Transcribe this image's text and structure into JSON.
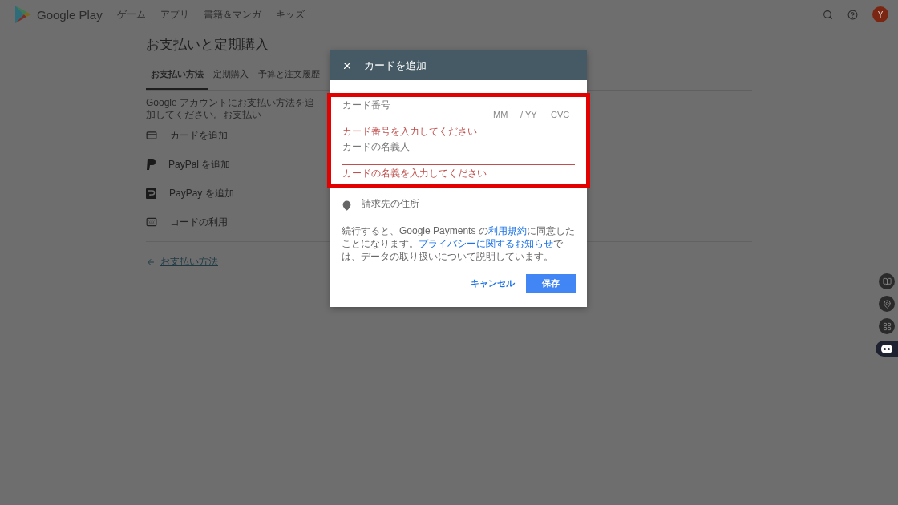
{
  "header": {
    "brand": "Google Play",
    "nav": [
      {
        "label": "ゲーム",
        "selected": false
      },
      {
        "label": "アプリ",
        "selected": false
      },
      {
        "label": "書籍＆マンガ",
        "selected": false
      },
      {
        "label": "キッズ",
        "selected": false
      }
    ],
    "avatar": "Y"
  },
  "page": {
    "title": "お支払いと定期購入",
    "tabs": [
      {
        "label": "お支払い方法",
        "selected": true
      },
      {
        "label": "定期購入",
        "selected": false
      },
      {
        "label": "予算と注文履歴",
        "selected": false
      }
    ],
    "description": "Google アカウントにお支払い方法を追加してください。お支払い",
    "methods": [
      {
        "kind": "card",
        "label": "カードを追加"
      },
      {
        "kind": "paypal",
        "label": "PayPal を追加"
      },
      {
        "kind": "paypay",
        "label": "PayPay を追加"
      },
      {
        "kind": "code",
        "label": "コードの利用"
      }
    ],
    "back_link": "お支払い方法"
  },
  "dialog": {
    "title": "カードを追加",
    "highlighted": true,
    "card_number": {
      "label": "カード番号",
      "error": "カード番号を入力してください"
    },
    "expiry_month": {
      "placeholder": "MM"
    },
    "expiry_year": {
      "placeholder": "/ YY"
    },
    "cvc": {
      "placeholder": "CVC"
    },
    "cardholder": {
      "label": "カードの名義人",
      "error": "カードの名義を入力してください"
    },
    "address": {
      "placeholder": "請求先の住所"
    },
    "terms": [
      {
        "text": "続行すると、Google Payments の",
        "link": false
      },
      {
        "text": "利用規約",
        "link": true
      },
      {
        "text": "に同意したことになります。",
        "link": false
      },
      {
        "text": "プライバシーに関するお知らせ",
        "link": true
      },
      {
        "text": "では、データの取り扱いについて説明しています。",
        "link": false
      }
    ],
    "buttons": [
      {
        "kind": "text",
        "label": "キャンセル"
      },
      {
        "kind": "filled",
        "label": "保存"
      }
    ]
  },
  "side_buttons": [
    {
      "kind": "book",
      "selected": false
    },
    {
      "kind": "pin",
      "selected": false
    },
    {
      "kind": "grid",
      "selected": false
    },
    {
      "kind": "bot",
      "selected": true
    }
  ]
}
